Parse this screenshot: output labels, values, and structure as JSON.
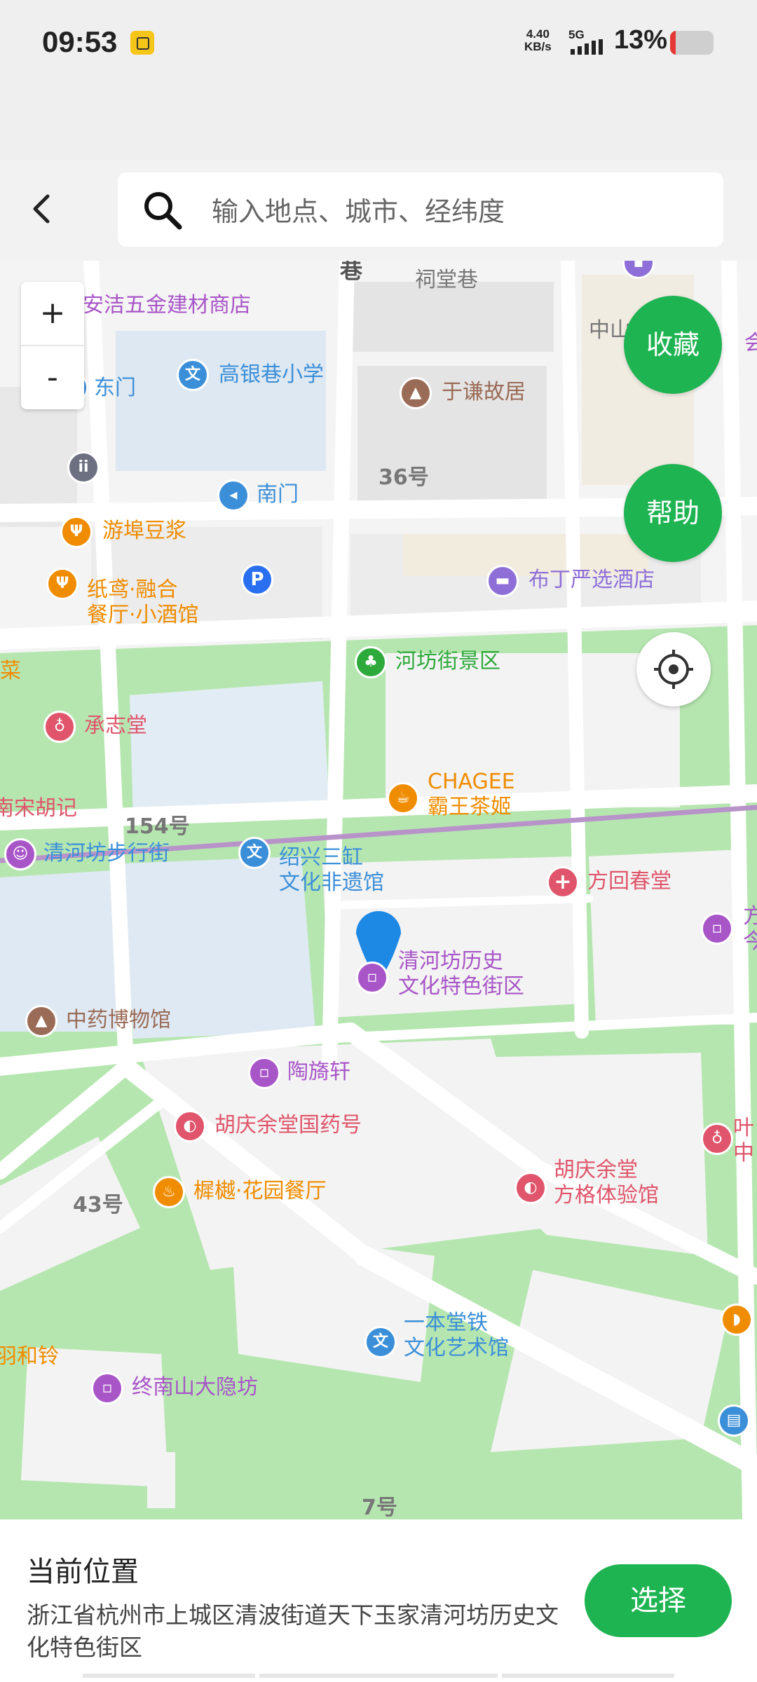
{
  "status_bar": {
    "time": "09:53",
    "net_speed_value": "4.40",
    "net_speed_unit": "KB/s",
    "network_type": "5G",
    "battery_text": "13%",
    "battery_level": 0.13
  },
  "header": {
    "search_placeholder": "输入地点、城市、经纬度"
  },
  "map": {
    "zoom_in_label": "+",
    "zoom_out_label": "-",
    "favorite_label": "收藏",
    "help_label": "帮助",
    "street_numbers": [
      "36号",
      "154号",
      "43号",
      "7号"
    ],
    "edge_labels": {
      "top_small": "巷",
      "citang_lane": "祠堂巷",
      "zhongshan": "中山",
      "cai": "菜",
      "songhu": "南宋胡记",
      "heling": "羽和铃",
      "right_top_partial": "会",
      "right_fang": "方",
      "right_jin": "今",
      "right_ye": "叶",
      "right_zhong": "中"
    },
    "pois": {
      "anjie": "安洁五金建材商店",
      "gaoyinxiang": "高银巷小学",
      "dongmen": "东门",
      "yuqian": "于谦故居",
      "nanmen": "南门",
      "youbu": "游埠豆浆",
      "zhiyuan_1": "纸鸢·融合",
      "zhiyuan_2": "餐厅·小酒馆",
      "parking": "P",
      "budingyan": "布丁严选酒店",
      "hefang": "河坊街景区",
      "chengzhitang": "承志堂",
      "chagee_1": "CHAGEE",
      "chagee_2": "霸王茶姬",
      "qinghefang_walk": "清河坊步行街",
      "shaoxing_1": "绍兴三缸",
      "shaoxing_2": "文化非遗馆",
      "fanghui": "方回春堂",
      "qinghefang_hist_1": "清河坊历史",
      "qinghefang_hist_2": "文化特色街区",
      "tcm_museum": "中药博物馆",
      "taoyixuan": "陶旖轩",
      "huqingyu": "胡庆余堂国药号",
      "chenghuai": "樨樾·花园餐厅",
      "huqingyu_fangge_1": "胡庆余堂",
      "huqingyu_fangge_2": "方格体验馆",
      "yibentang_1": "一本堂铁",
      "yibentang_2": "文化艺术馆",
      "zhongnanshan": "终南山大隐坊"
    }
  },
  "bottom_panel": {
    "title": "当前位置",
    "address": "浙江省杭州市上城区清波街道天下玉家清河坊历史文化特色街区",
    "select_label": "选择"
  },
  "colors": {
    "accent_green": "#1fb452",
    "map_green": "#b6e6b0",
    "marker_blue": "#1e88e5"
  }
}
